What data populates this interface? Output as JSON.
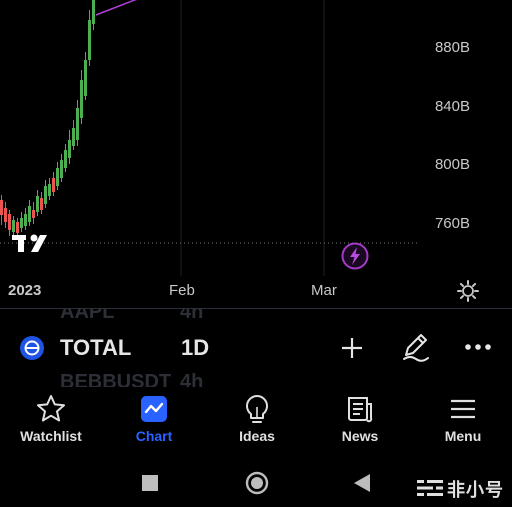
{
  "chart": {
    "price_ticks": [
      "880B",
      "840B",
      "800B",
      "760B"
    ],
    "time_ticks": [
      "2023",
      "Feb",
      "Mar"
    ],
    "logo_text": "TV"
  },
  "symbol_bar": {
    "prev_symbol": "AAPL",
    "prev_interval": "4h",
    "symbol": "TOTAL",
    "interval": "1D",
    "next_symbol": "BEBBUSDT",
    "next_interval": "4h"
  },
  "nav": {
    "items": [
      {
        "label": "Watchlist",
        "icon": "star-icon",
        "active": false
      },
      {
        "label": "Chart",
        "icon": "chart-icon",
        "active": true
      },
      {
        "label": "Ideas",
        "icon": "lightbulb-icon",
        "active": false
      },
      {
        "label": "News",
        "icon": "newspaper-icon",
        "active": false
      },
      {
        "label": "Menu",
        "icon": "menu-icon",
        "active": false
      }
    ]
  },
  "watermark": "非小号",
  "colors": {
    "up": "#4caf50",
    "down": "#ef5350",
    "accent": "#2962ff",
    "lightning": "#9c27b0"
  }
}
